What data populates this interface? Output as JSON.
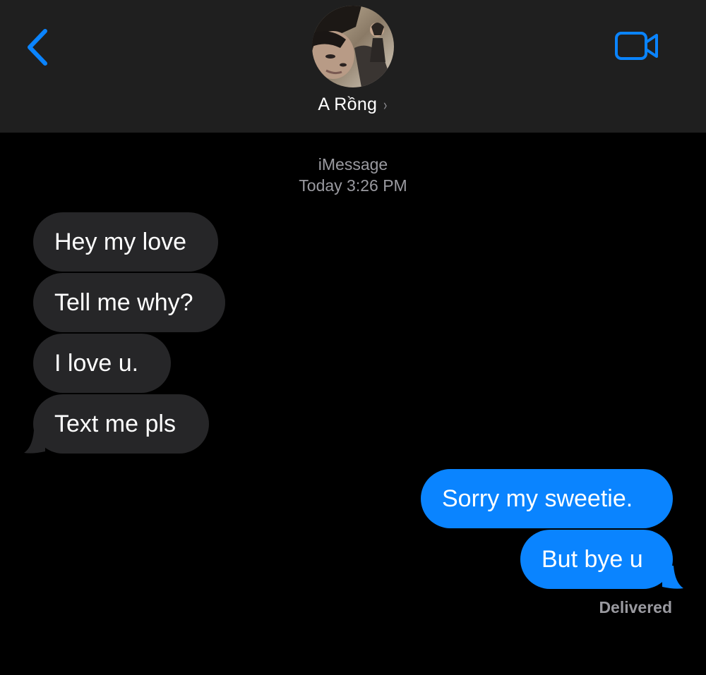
{
  "header": {
    "contact_name": "A Rồng",
    "chevron": "›",
    "back_icon": "chevron-left-icon",
    "video_icon": "video-camera-icon",
    "accent_color": "#0a84ff"
  },
  "conversation": {
    "service_label": "iMessage",
    "timestamp": "Today 3:26 PM",
    "incoming": [
      {
        "text": "Hey my love"
      },
      {
        "text": "Tell me why?"
      },
      {
        "text": "I love u."
      },
      {
        "text": "Text me pls"
      }
    ],
    "outgoing": [
      {
        "text": "Sorry my sweetie."
      },
      {
        "text": "But bye u"
      }
    ],
    "status": "Delivered"
  },
  "colors": {
    "header_bg": "#1f1f1f",
    "incoming_bubble": "#262628",
    "outgoing_bubble": "#0a84ff",
    "meta_text": "#9a9aa0"
  }
}
